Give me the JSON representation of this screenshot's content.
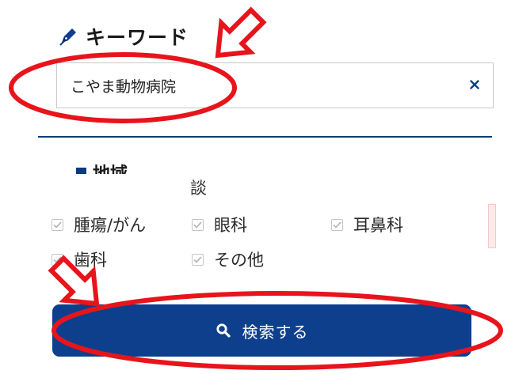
{
  "keyword_section": {
    "heading": "キーワード",
    "input_value": "こやま動物病院",
    "clear_icon": "close-icon"
  },
  "region_section": {
    "heading": "地域",
    "partial_text": "談"
  },
  "categories": [
    {
      "label": "腫瘍/がん",
      "checked": true
    },
    {
      "label": "眼科",
      "checked": true
    },
    {
      "label": "耳鼻科",
      "checked": true
    },
    {
      "label": "歯科",
      "checked": true
    },
    {
      "label": "その他",
      "checked": true
    }
  ],
  "search_button": {
    "label": "検索する",
    "icon": "search-icon"
  },
  "colors": {
    "primary": "#0e3f8d",
    "divider": "#0d3a78",
    "annotation": "#e8141c"
  }
}
